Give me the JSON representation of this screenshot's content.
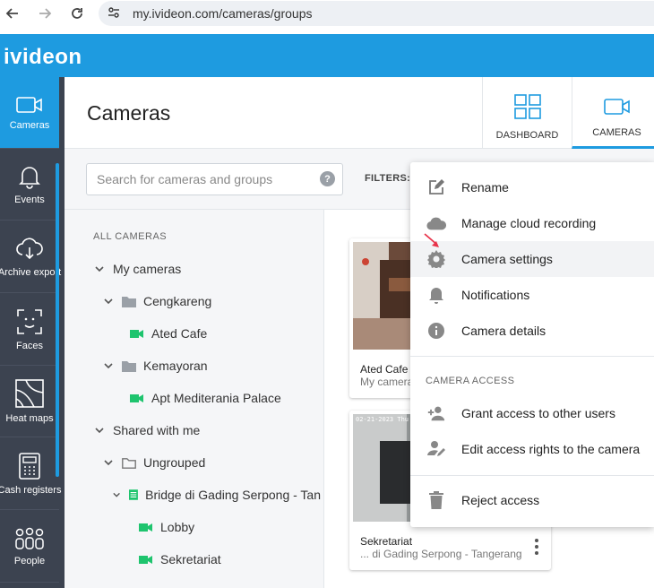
{
  "browser": {
    "url": "my.ivideon.com/cameras/groups"
  },
  "app": {
    "logo": "ivideon"
  },
  "sidebar": {
    "items": [
      {
        "label": "Cameras",
        "icon": "camera-icon"
      },
      {
        "label": "Events",
        "icon": "bell-icon"
      },
      {
        "label": "Archive export",
        "icon": "cloud-download-icon"
      },
      {
        "label": "Faces",
        "icon": "face-scan-icon"
      },
      {
        "label": "Heat maps",
        "icon": "heatmap-icon"
      },
      {
        "label": "Cash registers",
        "icon": "cash-register-icon"
      },
      {
        "label": "People",
        "icon": "people-icon"
      }
    ]
  },
  "page": {
    "title": "Cameras"
  },
  "views": {
    "dashboard": "DASHBOARD",
    "cameras": "CAMERAS"
  },
  "search": {
    "placeholder": "Search for cameras and groups",
    "help": "?"
  },
  "filters": {
    "label": "FILTERS:"
  },
  "tree": {
    "heading": "ALL CAMERAS",
    "my_cameras": "My cameras",
    "cengkareng": "Cengkareng",
    "ated_cafe": "Ated Cafe",
    "kemayoran": "Kemayoran",
    "apt_mediterania": "Apt Mediterania Palace",
    "shared": "Shared with me",
    "ungrouped": "Ungrouped",
    "bridge": "Bridge di Gading Serpong - Tan",
    "lobby": "Lobby",
    "sekretariat": "Sekretariat"
  },
  "cards": [
    {
      "name": "Ated Cafe",
      "sub": "My camera"
    },
    {
      "name": "Sekretariat",
      "sub": "... di Gading Serpong - Tangerang",
      "timestamp": "02-21-2023 Thu 10:14"
    }
  ],
  "menu": {
    "rename": "Rename",
    "cloud": "Manage cloud recording",
    "settings": "Camera settings",
    "notifications": "Notifications",
    "details": "Camera details",
    "access_section": "CAMERA ACCESS",
    "grant": "Grant access to other users",
    "edit_rights": "Edit access rights to the camera",
    "reject": "Reject access"
  },
  "colors": {
    "brand": "#1e9be0",
    "sidebar": "#3c4350",
    "camera_online": "#1ec46e"
  }
}
